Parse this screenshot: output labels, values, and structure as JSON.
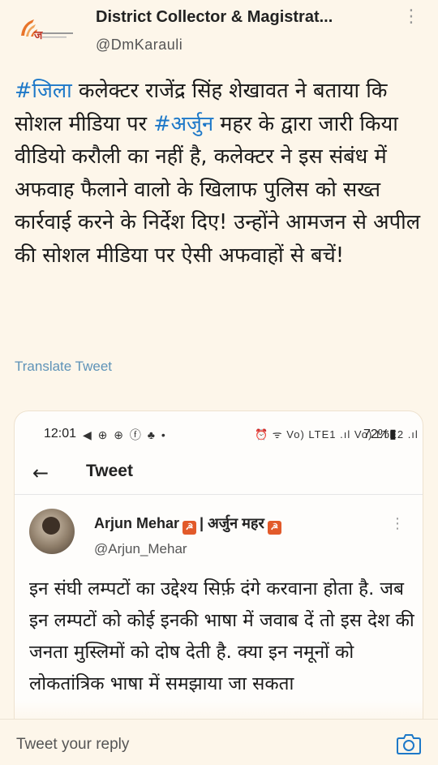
{
  "tweet": {
    "author_name": "District Collector & Magistrat...",
    "author_handle": "@DmKarauli",
    "body_segments": [
      {
        "text": "#जिला",
        "hashtag": true
      },
      {
        "text": " कलेक्टर राजेंद्र सिंह शेखावत ने बताया कि सोशल मीडिया पर ",
        "hashtag": false
      },
      {
        "text": "#अर्जुन",
        "hashtag": true
      },
      {
        "text": " महर के द्वारा जारी किया वीडियो करौली का नहीं है, कलेक्टर ने इस संबंध में अफवाह फैलाने वालो के खिलाफ पुलिस को सख्त कार्रवाई करने के निर्देश दिए! उन्होंने आमजन से अपील की सोशल मीडिया पर ऐसी अफवाहों से बचें!",
        "hashtag": false
      }
    ],
    "translate_label": "Translate Tweet"
  },
  "embedded_screenshot": {
    "status_bar": {
      "time": "12:01",
      "left_icons": "◀ ⊕ ⊕ ⓕ ♣ •",
      "right_icons": "⏰ ᯤ Vo) LTE1 .ıl Vo) LTE2 .ıl",
      "battery": "72%"
    },
    "nav": {
      "title": "Tweet"
    },
    "tweet": {
      "author_name": "Arjun Mehar",
      "author_name_hindi": "| अर्जुन महर",
      "author_handle": "@Arjun_Mehar",
      "text": "इन संघी लम्पटों का उद्देश्य सिर्फ़ दंगे करवाना होता है. जब इन लम्पटों को कोई इनकी भाषा में जवाब दें तो इस देश की जनता मुस्लिमों को दोष देती है. क्या इन नमूनों को लोकतांत्रिक भाषा में समझाया जा सकता"
    }
  },
  "reply": {
    "placeholder": "Tweet your reply"
  },
  "colors": {
    "background": "#fdf6ea",
    "hashtag": "#1d78c8",
    "translate": "#5e93b8",
    "flag": "#e25a2a"
  }
}
